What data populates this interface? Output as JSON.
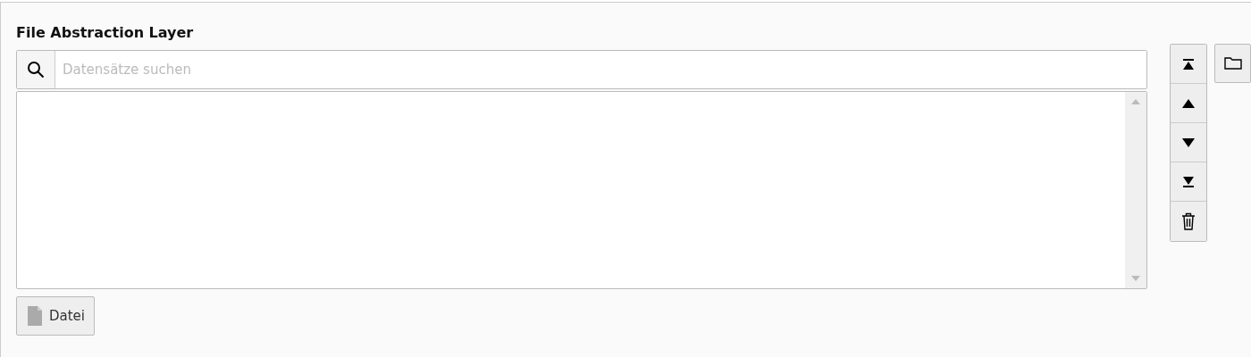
{
  "title": "File Abstraction Layer",
  "search": {
    "placeholder": "Datensätze suchen"
  },
  "list_controls": [
    {
      "kind": "top"
    },
    {
      "kind": "up"
    },
    {
      "kind": "down"
    },
    {
      "kind": "bottom"
    },
    {
      "kind": "delete"
    }
  ],
  "browse_button": {
    "kind": "folder"
  },
  "add_button": {
    "label": "Datei"
  }
}
